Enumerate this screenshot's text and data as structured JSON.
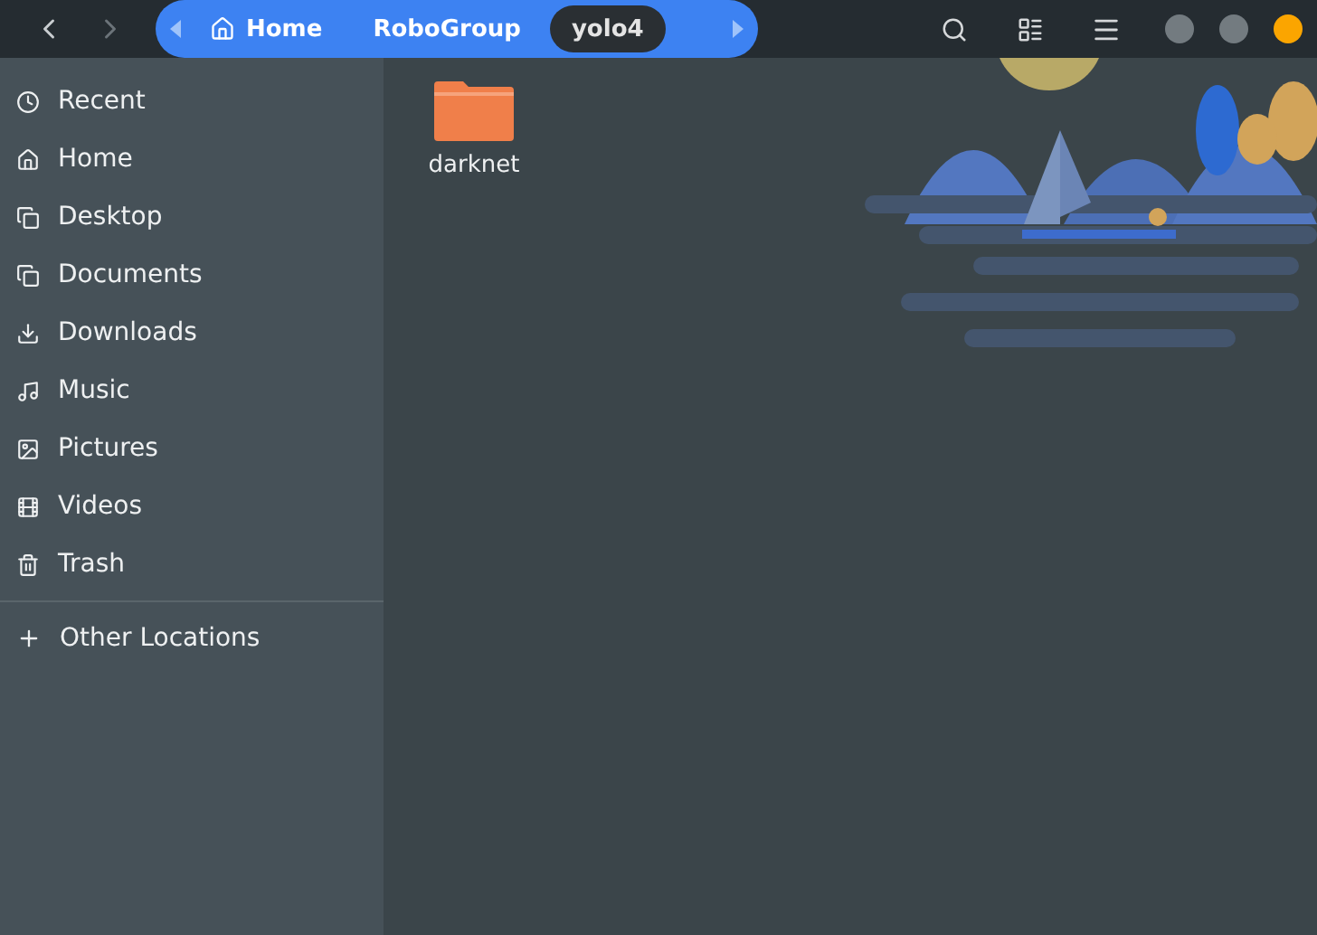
{
  "breadcrumbs": [
    {
      "label": "Home",
      "selected": false
    },
    {
      "label": "RoboGroup",
      "selected": false
    },
    {
      "label": "yolo4",
      "selected": true
    }
  ],
  "sidebar": {
    "items": [
      "Recent",
      "Home",
      "Desktop",
      "Documents",
      "Downloads",
      "Music",
      "Pictures",
      "Videos",
      "Trash"
    ],
    "other": "Other Locations"
  },
  "files": [
    {
      "name": "darknet"
    }
  ]
}
